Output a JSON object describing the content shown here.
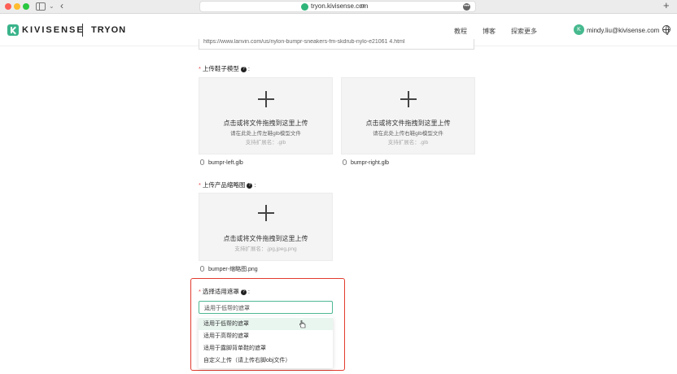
{
  "browser": {
    "url": "tryon.kivisense.com",
    "new_tab_symbol": "+",
    "back_symbol": "‹"
  },
  "header": {
    "logo_text": "KIVISENSE",
    "product_name": "TRYON",
    "nav": [
      "教程",
      "博客",
      "探索更多"
    ],
    "avatar_letter": "K",
    "user_email": "mindy.liu@kivisense.com"
  },
  "form": {
    "product_url_value": "https://www.lanvin.com/us/nylon-bumpr-sneakers-fm-skdrub-nylo-e21061 4.html",
    "shoe_model": {
      "label": "上传鞋子模型",
      "left_box": {
        "main": "点击或将文件拖拽到这里上传",
        "sub": "请在此处上传左鞋glb模型文件",
        "ext": "支持扩展名：.glb",
        "file": "bumpr-left.glb"
      },
      "right_box": {
        "main": "点击或将文件拖拽到这里上传",
        "sub": "请在此处上传右鞋glb模型文件",
        "ext": "支持扩展名：.glb",
        "file": "bumpr-right.glb"
      }
    },
    "thumbnail": {
      "label": "上传产品缩略图",
      "box": {
        "main": "点击或将文件拖拽到这里上传",
        "ext": "支持扩展名：.jpg,jpeg,png"
      },
      "file": "bumper-缩略图.png"
    },
    "mask": {
      "label": "选择适用遮罩",
      "selected": "适用于低帮的遮罩",
      "options": [
        "适用于低帮的遮罩",
        "适用于高帮的遮罩",
        "适用于露脚背单鞋的遮罩",
        "自定义上传（请上传右脚obj文件）"
      ],
      "hovered_index": 0
    }
  },
  "colors": {
    "accent": "#3ab38b",
    "highlight": "#e23b2e",
    "required": "#e64b4b"
  }
}
